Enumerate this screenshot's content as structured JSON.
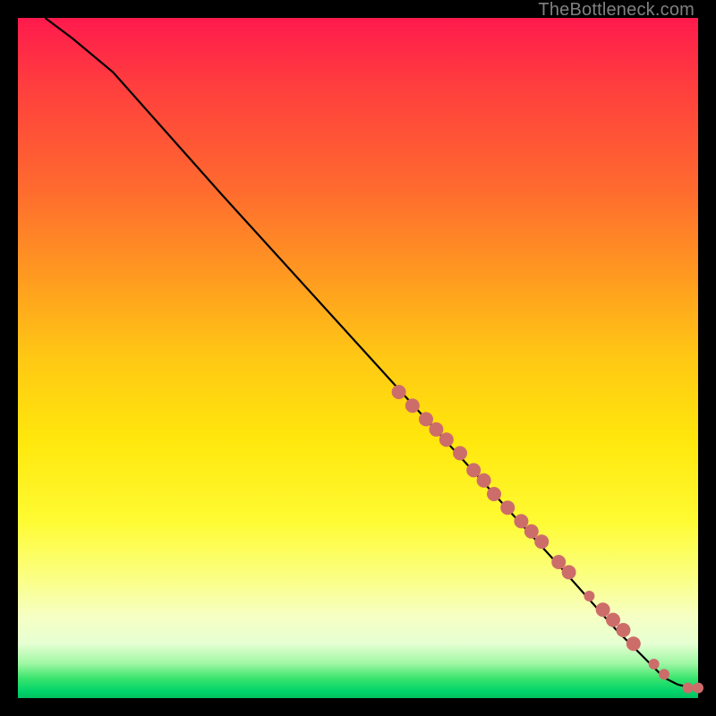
{
  "watermark": "TheBottleneck.com",
  "chart_data": {
    "type": "line",
    "title": "",
    "xlabel": "",
    "ylabel": "",
    "xlim": [
      0,
      100
    ],
    "ylim": [
      0,
      100
    ],
    "grid": false,
    "legend": false,
    "background_gradient": {
      "direction": "vertical",
      "stops": [
        "#ff1a4d",
        "#ff6a2f",
        "#ffc814",
        "#fffb33",
        "#f6ffc4",
        "#3de56f",
        "#00c060"
      ]
    },
    "series": [
      {
        "name": "bottleneck-curve",
        "color": "#000000",
        "x": [
          4,
          8,
          14,
          30,
          50,
          70,
          80,
          88,
          92,
          95,
          97,
          99,
          100
        ],
        "y": [
          100,
          97,
          92,
          74,
          52,
          30,
          19,
          10,
          6,
          3,
          2,
          1.5,
          1.5
        ]
      }
    ],
    "markers": {
      "name": "highlight-points",
      "color": "#cd6d6a",
      "radius_major": 8,
      "radius_minor": 6,
      "points": [
        {
          "x": 56,
          "y": 45,
          "r": 8
        },
        {
          "x": 58,
          "y": 43,
          "r": 8
        },
        {
          "x": 60,
          "y": 41,
          "r": 8
        },
        {
          "x": 61.5,
          "y": 39.5,
          "r": 8
        },
        {
          "x": 63,
          "y": 38,
          "r": 8
        },
        {
          "x": 65,
          "y": 36,
          "r": 8
        },
        {
          "x": 67,
          "y": 33.5,
          "r": 8
        },
        {
          "x": 68.5,
          "y": 32,
          "r": 8
        },
        {
          "x": 70,
          "y": 30,
          "r": 8
        },
        {
          "x": 72,
          "y": 28,
          "r": 8
        },
        {
          "x": 74,
          "y": 26,
          "r": 8
        },
        {
          "x": 75.5,
          "y": 24.5,
          "r": 8
        },
        {
          "x": 77,
          "y": 23,
          "r": 8
        },
        {
          "x": 79.5,
          "y": 20,
          "r": 8
        },
        {
          "x": 81,
          "y": 18.5,
          "r": 8
        },
        {
          "x": 84,
          "y": 15,
          "r": 6
        },
        {
          "x": 86,
          "y": 13,
          "r": 8
        },
        {
          "x": 87.5,
          "y": 11.5,
          "r": 8
        },
        {
          "x": 89,
          "y": 10,
          "r": 8
        },
        {
          "x": 90.5,
          "y": 8,
          "r": 8
        },
        {
          "x": 93.5,
          "y": 5,
          "r": 6
        },
        {
          "x": 95,
          "y": 3.5,
          "r": 6
        },
        {
          "x": 98.5,
          "y": 1.5,
          "r": 6
        },
        {
          "x": 100,
          "y": 1.5,
          "r": 6
        }
      ]
    }
  }
}
